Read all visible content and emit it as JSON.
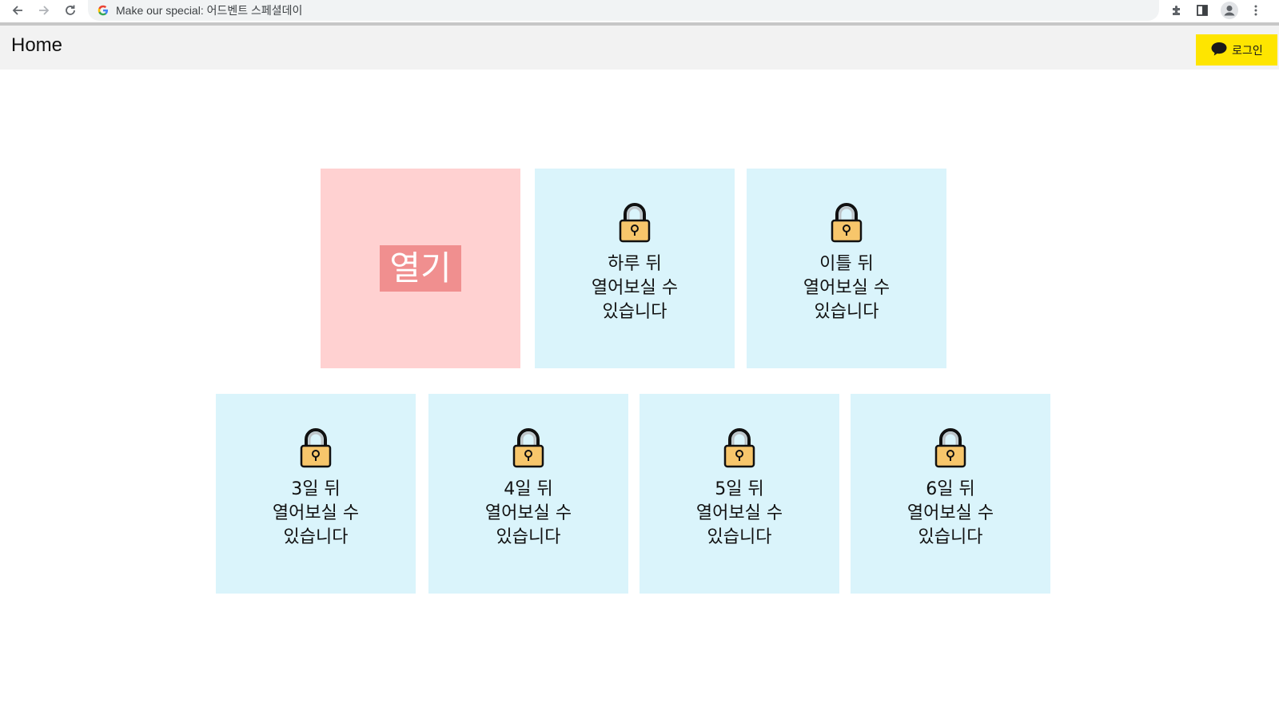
{
  "browser": {
    "url_text": "Make our special: 어드벤트 스페셜데이"
  },
  "header": {
    "title": "Home",
    "login_label": "로그인"
  },
  "colors": {
    "header_bg": "#f2f2f2",
    "kakao_yellow": "#fee500",
    "locked_card_bg": "#daf4fb",
    "open_card_bg": "#ffd1d1",
    "open_button_bg": "#f08f8f"
  },
  "cards": [
    {
      "state": "open",
      "button_label": "열기"
    },
    {
      "state": "locked",
      "icon": "padlock-icon",
      "line1": "하루 뒤",
      "line2": "열어보실 수",
      "line3": "있습니다"
    },
    {
      "state": "locked",
      "icon": "padlock-icon",
      "line1": "이틀 뒤",
      "line2": "열어보실 수",
      "line3": "있습니다"
    },
    {
      "state": "locked",
      "icon": "padlock-icon",
      "line1": "3일 뒤",
      "line2": "열어보실 수",
      "line3": "있습니다"
    },
    {
      "state": "locked",
      "icon": "padlock-icon",
      "line1": "4일 뒤",
      "line2": "열어보실 수",
      "line3": "있습니다"
    },
    {
      "state": "locked",
      "icon": "padlock-icon",
      "line1": "5일 뒤",
      "line2": "열어보실 수",
      "line3": "있습니다"
    },
    {
      "state": "locked",
      "icon": "padlock-icon",
      "line1": "6일 뒤",
      "line2": "열어보실 수",
      "line3": "있습니다"
    }
  ]
}
